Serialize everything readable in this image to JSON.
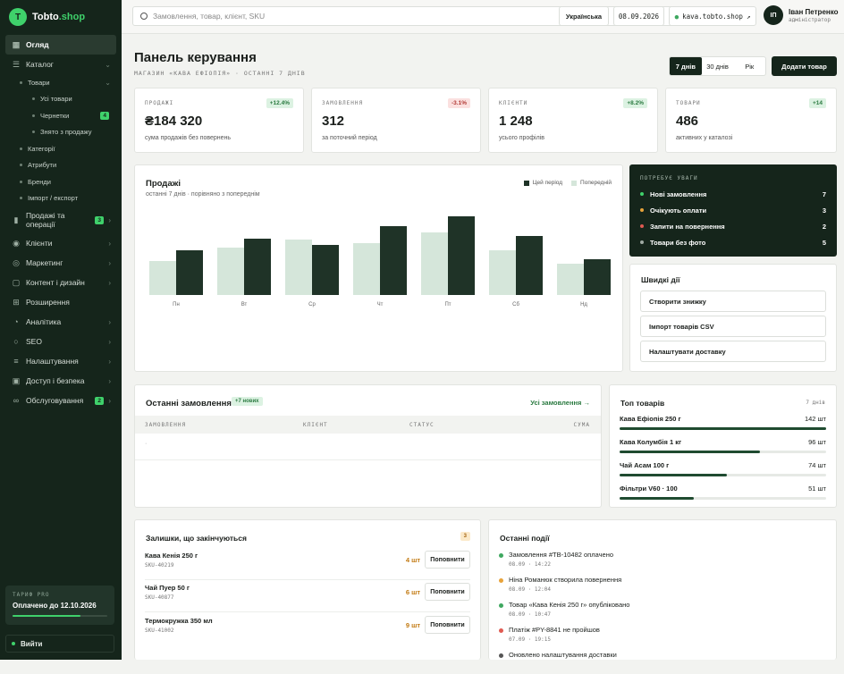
{
  "brand": {
    "mark": "T",
    "name": "Tobto",
    "suffix": ".shop"
  },
  "nav": {
    "overview": "Огляд",
    "catalog": "Каталог",
    "products": "Товари",
    "all_products": "Усі товари",
    "drafts": "Чернетки",
    "drafts_badge": "4",
    "archived": "Знято з продажу",
    "categories": "Категорії",
    "attributes": "Атрибути",
    "brands": "Бренди",
    "import_export": "Імпорт / експорт",
    "sales": "Продажі та операції",
    "sales_badge": "3",
    "clients": "Клієнти",
    "marketing": "Маркетинг",
    "content": "Контент і дизайн",
    "extensions": "Розширення",
    "analytics": "Аналітика",
    "seo": "SEO",
    "settings": "Налаштування",
    "access": "Доступ і безпека",
    "service": "Обслуговування",
    "service_badge": "2"
  },
  "plan": {
    "label": "ТАРИФ PRO",
    "value": "Оплачено до 12.10.2026",
    "progress": 0.72
  },
  "logout": "Вийти",
  "topbar": {
    "search_placeholder": "Замовлення, товар, клієнт, SKU",
    "lang": "Українська",
    "date": "08.09.2026",
    "domain": "kava.tobto.shop",
    "user_initials": "ІП",
    "user_name": "Іван Петренко",
    "user_role": "адміністратор"
  },
  "header": {
    "title": "Панель керування",
    "subtitle": "МАГАЗИН «КАВА ЕФІОПІЯ» · ОСТАННІ 7 ДНІВ",
    "periods": [
      "7 днів",
      "30 днів",
      "Рік"
    ],
    "add_button": "Додати товар"
  },
  "kpis": [
    {
      "label": "ПРОДАЖІ",
      "change": "+12.4%",
      "value": "₴184 320",
      "sub": "сума продажів без повернень",
      "trend": "up"
    },
    {
      "label": "ЗАМОВЛЕННЯ",
      "change": "-3.1%",
      "value": "312",
      "sub": "за поточний період",
      "trend": "down"
    },
    {
      "label": "КЛІЄНТИ",
      "change": "+8.2%",
      "value": "1 248",
      "sub": "усього профілів",
      "trend": "up"
    },
    {
      "label": "ТОВАРИ",
      "change": "+14",
      "value": "486",
      "sub": "активних у каталозі",
      "trend": "up"
    }
  ],
  "sales_card": {
    "title": "Продажі",
    "subtitle": "останні 7 днів · порівняно з попереднім",
    "legend_current": "Цей період",
    "legend_previous": "Попередній"
  },
  "chart_data": {
    "type": "bar",
    "categories": [
      "Пн",
      "Вт",
      "Ср",
      "Чт",
      "Пт",
      "Сб",
      "Нд"
    ],
    "series": [
      {
        "name": "Попередній",
        "values": [
          38,
          53,
          62,
          58,
          70,
          50,
          35
        ],
        "color": "#d5e6da"
      },
      {
        "name": "Цей період",
        "values": [
          50,
          63,
          56,
          77,
          88,
          66,
          40
        ],
        "color": "#1f3327"
      }
    ],
    "ylim": [
      0,
      100
    ]
  },
  "attention": {
    "title": "ПОТРЕБУЄ УВАГИ",
    "items": [
      {
        "label": "Нові замовлення",
        "count": "7",
        "color": "#3fd16b"
      },
      {
        "label": "Очікують оплати",
        "count": "3",
        "color": "#e8a33a"
      },
      {
        "label": "Запити на повернення",
        "count": "2",
        "color": "#e05a52"
      },
      {
        "label": "Товари без фото",
        "count": "5",
        "color": "#a0aba4"
      }
    ]
  },
  "quick": {
    "title": "Швидкі дії",
    "items": [
      "Створити знижку",
      "Імпорт товарів CSV",
      "Налаштувати доставку"
    ]
  },
  "orders": {
    "title": "Останні замовлення",
    "tag": "+7 нових",
    "link": "Усі замовлення →",
    "cols": [
      "ЗАМОВЛЕННЯ",
      "КЛІЄНТ",
      "СТАТУС",
      "СУМА"
    ],
    "empty": "·"
  },
  "top": {
    "title": "Топ товарів",
    "period": "7 днів",
    "items": [
      {
        "name": "Кава Ефіопія 250 г",
        "value": "142 шт",
        "share": 1.0
      },
      {
        "name": "Кава Колумбія 1 кг",
        "value": "96 шт",
        "share": 0.68
      },
      {
        "name": "Чай Асам 100 г",
        "value": "74 шт",
        "share": 0.52
      },
      {
        "name": "Фільтри V60 · 100",
        "value": "51 шт",
        "share": 0.36
      }
    ]
  },
  "stock": {
    "title": "Залишки, що закінчуються",
    "count": "3",
    "button": "Поповнити",
    "items": [
      {
        "name": "Кава Кенія 250 г",
        "sku": "SKU-40219",
        "qty": "4 шт"
      },
      {
        "name": "Чай Пуер 50 г",
        "sku": "SKU-40877",
        "qty": "6 шт"
      },
      {
        "name": "Термокружка 350 мл",
        "sku": "SKU-41002",
        "qty": "9 шт"
      }
    ]
  },
  "events": {
    "title": "Останні події",
    "items": [
      {
        "text": "Замовлення #TB-10482 оплачено",
        "time": "08.09 · 14:22",
        "color": "#3fa860"
      },
      {
        "text": "Ніна Романюк створила повернення",
        "time": "08.09 · 12:04",
        "color": "#e8a33a"
      },
      {
        "text": "Товар «Кава Кенія 250 г» опубліковано",
        "time": "08.09 · 10:47",
        "color": "#3fa860"
      },
      {
        "text": "Платіж #PY-8841 не пройшов",
        "time": "07.09 · 19:15",
        "color": "#e05a52"
      },
      {
        "text": "Оновлено налаштування доставки",
        "time": "",
        "color": "#555"
      }
    ]
  }
}
